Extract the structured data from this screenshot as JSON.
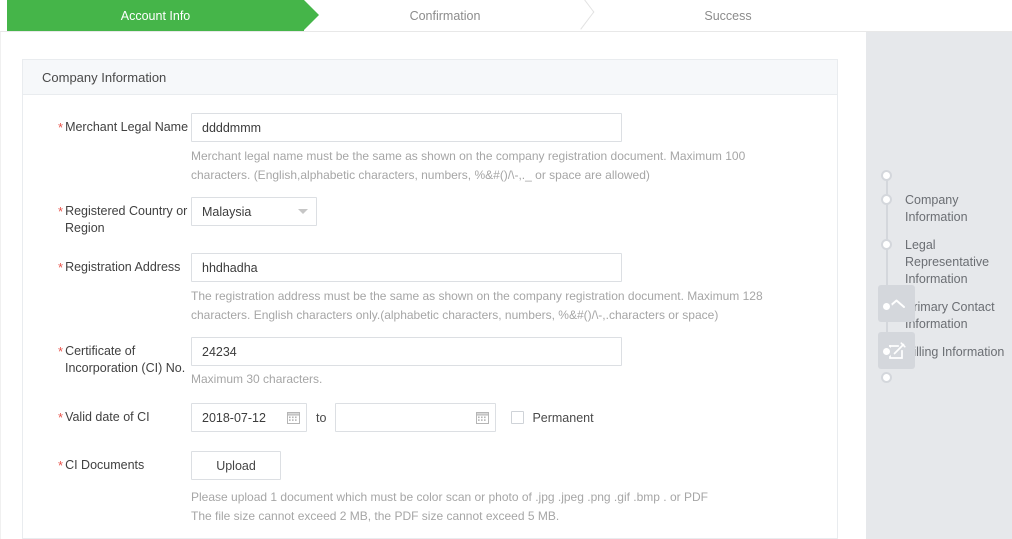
{
  "steps": [
    {
      "label": "Account Info",
      "state": "active"
    },
    {
      "label": "Confirmation",
      "state": "inactive"
    },
    {
      "label": "Success",
      "state": "inactive"
    }
  ],
  "card": {
    "title": "Company Information"
  },
  "form": {
    "merchant_legal_name": {
      "label": "Merchant Legal Name",
      "required_mark": "*",
      "value": "ddddmmm",
      "placeholder": "",
      "help": "Merchant legal name must be the same as shown on the company registration document. Maximum 100 characters. (English,alphabetic characters, numbers, %&#()/\\-,._ or space are allowed)"
    },
    "registered_country": {
      "label_line1": "Registered Country or",
      "label_line2": "Region",
      "required_mark": "*",
      "value": "Malaysia",
      "caret": "chevron-down-icon"
    },
    "registration_address": {
      "label": "Registration Address",
      "required_mark": "*",
      "value": "hhdhadha",
      "placeholder": "",
      "help": "The registration address must be the same as shown on the company registration document. Maximum 128 characters. English characters only.(alphabetic characters, numbers, %&#()/\\-,.characters or space)"
    },
    "ci_number": {
      "label_line1": "Certificate of",
      "label_line2": "Incorporation (CI) No.",
      "required_mark": "*",
      "value": "24234",
      "placeholder": "",
      "help": "Maximum 30 characters."
    },
    "valid_date": {
      "label": "Valid date of CI",
      "required_mark": "*",
      "from_value": "2018-07-12",
      "to_value": "",
      "separator": "to",
      "permanent_label": "Permanent",
      "permanent_checked": false,
      "calendar_icon": "calendar-icon"
    },
    "ci_documents": {
      "label": "CI Documents",
      "required_mark": "*",
      "upload_label": "Upload",
      "help_line1": "Please upload 1 document which must be color scan or photo of .jpg .jpeg .png .gif .bmp . or PDF",
      "help_line2": "The file size cannot exceed 2 MB, the PDF size cannot exceed 5 MB."
    }
  },
  "rail": {
    "items": [
      {
        "label": "Company Information"
      },
      {
        "label": "Legal Representative Information"
      },
      {
        "label": "Primary Contact Information"
      },
      {
        "label": "Billing Information"
      }
    ],
    "buttons": [
      {
        "name": "scroll-to-top",
        "icon": "chevron-up-icon"
      },
      {
        "name": "feedback",
        "icon": "edit-square-icon"
      }
    ]
  },
  "colors": {
    "accent_green": "#45b549",
    "required_red": "#e8524a",
    "rail_bg": "#e6e8eb",
    "help_gray": "#a6a6a6"
  }
}
